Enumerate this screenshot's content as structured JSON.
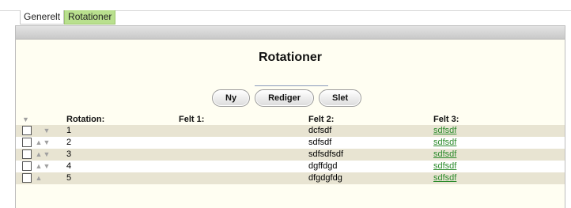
{
  "tabs": [
    {
      "label": "Generelt",
      "active": false
    },
    {
      "label": "Rotationer",
      "active": true
    }
  ],
  "page": {
    "title": "Rotationer"
  },
  "buttons": {
    "new": "Ny",
    "edit": "Rediger",
    "delete": "Slet"
  },
  "table": {
    "headers": {
      "rotation": "Rotation:",
      "felt1": "Felt 1:",
      "felt2": "Felt 2:",
      "felt3": "Felt 3:"
    },
    "rows": [
      {
        "rotation": "1",
        "felt1": "",
        "felt2": "dcfsdf",
        "felt3": "sdfsdf"
      },
      {
        "rotation": "2",
        "felt1": "",
        "felt2": "sdfsdf",
        "felt3": "sdfsdf"
      },
      {
        "rotation": "3",
        "felt1": "",
        "felt2": "sdfsdfsdf",
        "felt3": "sdfsdf"
      },
      {
        "rotation": "4",
        "felt1": "",
        "felt2": "dgffdgd",
        "felt3": "sdfsdf"
      },
      {
        "rotation": "5",
        "felt1": "",
        "felt2": "dfgdgfdg",
        "felt3": "sdfsdf"
      }
    ]
  },
  "colors": {
    "active_tab": "#b9e08e",
    "panel_bg": "#fffef2",
    "odd_row": "#e8e4d2",
    "link": "#2b8a2b"
  }
}
